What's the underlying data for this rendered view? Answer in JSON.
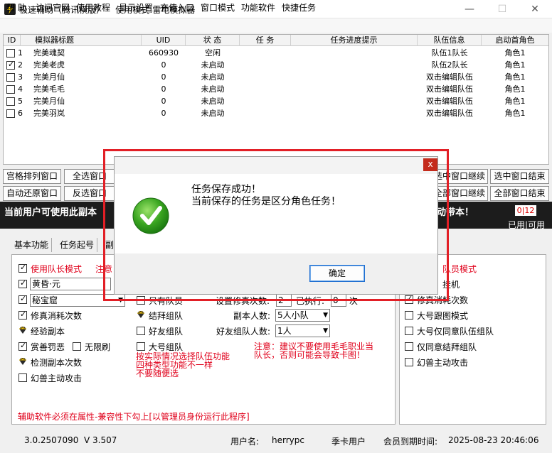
{
  "window": {
    "title": "极速辅助（腾讯横版）",
    "mode_label": "使用模式:",
    "mode_value": "雷电模拟器",
    "minimize": "—",
    "maximize": "☐",
    "close": "✕"
  },
  "menu": [
    "帮 助",
    "访问官网",
    "使用教程",
    "显示设置",
    "充值入口",
    "窗口模式",
    "功能软件",
    "快捷任务"
  ],
  "table": {
    "headers": [
      "ID",
      "模拟器标题",
      "UID",
      "状 态",
      "任 务",
      "任务进度提示",
      "队伍信息",
      "启动首角色"
    ],
    "rows": [
      {
        "id": "1",
        "checked": false,
        "title": "完美魂契",
        "uid": "660930",
        "status": "空闲",
        "team": "队伍1队长",
        "role": "角色1"
      },
      {
        "id": "2",
        "checked": true,
        "title": "完美老虎",
        "uid": "0",
        "status": "未启动",
        "team": "队伍2队长",
        "role": "角色1"
      },
      {
        "id": "3",
        "checked": false,
        "title": "完美月仙",
        "uid": "0",
        "status": "未启动",
        "team": "双击编辑队伍",
        "role": "角色1"
      },
      {
        "id": "4",
        "checked": false,
        "title": "完美毛毛",
        "uid": "0",
        "status": "未启动",
        "team": "双击编辑队伍",
        "role": "角色1"
      },
      {
        "id": "5",
        "checked": false,
        "title": "完美月仙",
        "uid": "0",
        "status": "未启动",
        "team": "双击编辑队伍",
        "role": "角色1"
      },
      {
        "id": "6",
        "checked": false,
        "title": "完美羽岚",
        "uid": "0",
        "status": "未启动",
        "team": "双击编辑队伍",
        "role": "角色1"
      }
    ]
  },
  "buttons": {
    "grid_arrange": "宫格排列窗口",
    "select_all": "全选窗口",
    "auto_restore": "自动还原窗口",
    "invert_select": "反选窗口",
    "selected_continue": "选中窗口继续",
    "selected_end": "选中窗口结束",
    "all_continue": "全部窗口继续",
    "all_end": "全部窗口结束"
  },
  "strip": {
    "left_text": "当前用户可使用此副本",
    "right_text": "动带本！",
    "counter": "0|12",
    "used_avail": "已用|可用"
  },
  "tabs": [
    "基本功能",
    "任务起号",
    "副"
  ],
  "left_panel": {
    "leader_mode": "使用队长模式",
    "notice": "注意",
    "dungeon_1": "黄昏·元",
    "dungeon_2": "秘宝窟",
    "only_team": "只有队员",
    "repair_times_label": "设置修真次数:",
    "repair_times_value": "2",
    "executed_label": "已执行:",
    "executed_value": "0",
    "times_unit": "次",
    "repair_consume": "修真消耗次数",
    "join_team": "结拜组队",
    "dungeon_people_label": "副本人数:",
    "dungeon_people_value": "5人小队",
    "exp_dungeon": "经验副本",
    "friend_team": "好友组队",
    "friend_people_label": "好友组队人数:",
    "friend_people_value": "1人",
    "reward_punish": "赏善罚恶",
    "unlimited_farm": "无限刷",
    "big_team": "大号组队",
    "detect_times": "检测副本次数",
    "phantom_attack": "幻兽主动攻击",
    "team_hint": "按实际情况选择队伍功能\n四种类型功能不一样\n不要随便选",
    "note_text": "注意：建议不要使用毛毛职业当\n队长，否则可能会导致卡图！",
    "admin_hint": "辅助软件必须在属性-兼容性下勾上[以管理员身份运行此程序]"
  },
  "right_panel": {
    "member_mode": "队员模式",
    "right_item_2": "挂机",
    "repair_consume": "修真消耗次数",
    "big_follow": "大号跟图模式",
    "big_only_agree": "大号仅同意队伍组队",
    "only_agree_join": "仅同意结拜组队",
    "phantom_attack": "幻兽主动攻击"
  },
  "footer": {
    "version": "3.0.2507090",
    "v": "V 3.507",
    "user_label": "用户名:",
    "user_name": "herrypc",
    "card_type": "季卡用户",
    "expire_label": "会员到期时间:",
    "expire_value": "2025-08-23 20:46:06"
  },
  "dialog": {
    "close": "x",
    "line1": "任务保存成功！",
    "line2": "当前保存的任务是区分角色任务！",
    "ok": "确定"
  }
}
